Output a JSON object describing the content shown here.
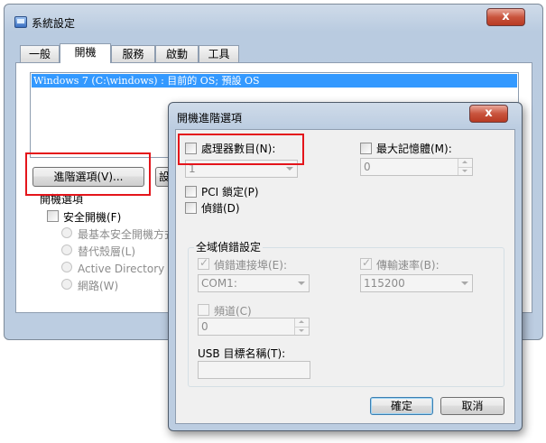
{
  "main_window": {
    "title": "系統設定",
    "tabs": [
      "一般",
      "開機",
      "服務",
      "啟動",
      "工具"
    ],
    "active_tab": "開機",
    "boot_entries": [
      "Windows 7 (C:\\windows) : 目前的 OS; 預設 OS"
    ],
    "advanced_button": "進階選項(V)...",
    "set_default_button_partial": "設",
    "boot_options_label": "開機選項",
    "safe_boot_label": "安全開機(F)",
    "safe_boot_options": [
      "最基本安全開機方式",
      "替代殼層(L)",
      "Active Directory 修復",
      "網路(W)"
    ]
  },
  "dialog": {
    "title": "開機進階選項",
    "close_label": "x",
    "num_processors_label": "處理器數目(N):",
    "num_processors_value": "1",
    "max_memory_label": "最大記憶體(M):",
    "max_memory_value": "0",
    "pci_lock_label": "PCI 鎖定(P)",
    "debug_label": "偵錯(D)",
    "global_debug_title": "全域偵錯設定",
    "debug_port_label": "偵錯連接埠(E):",
    "debug_port_value": "COM1:",
    "baud_rate_label": "傳輸速率(B):",
    "baud_rate_value": "115200",
    "channel_label": "頻道(C)",
    "channel_value": "0",
    "usb_target_label": "USB 目標名稱(T):",
    "usb_target_value": "",
    "ok_button": "確定",
    "cancel_button": "取消"
  },
  "colors": {
    "highlight": "#3399ff",
    "annotation_red": "#e4151b",
    "close_red": "#c9543d"
  }
}
